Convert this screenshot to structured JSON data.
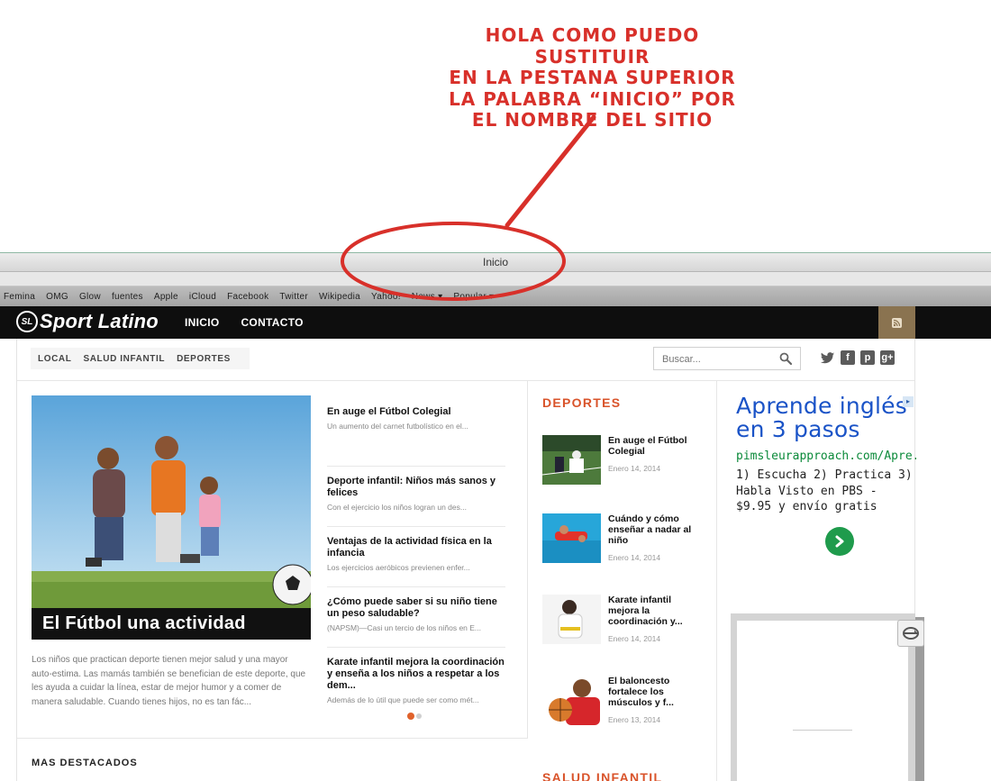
{
  "annotation": {
    "line1": "HOLA COMO PUEDO SUSTITUIR",
    "line2": "EN LA PESTANA SUPERIOR",
    "line3": "LA PALABRA “INICIO” POR",
    "line4": "EL NOMBRE DEL SITIO",
    "color": "#d8302a"
  },
  "browser": {
    "tab_title": "Inicio",
    "bookmarks": [
      "Femina",
      "OMG",
      "Glow",
      "fuentes",
      "Apple",
      "iCloud",
      "Facebook",
      "Twitter",
      "Wikipedia",
      "Yahoo!",
      "News ▾",
      "Popular ▾"
    ]
  },
  "header": {
    "logo_mark": "SL",
    "logo_text": "Sport Latino",
    "nav": [
      "INICIO",
      "CONTACTO"
    ],
    "rss_icon": "rss-icon",
    "accent": "#8a7350"
  },
  "subnav": {
    "items": [
      "LOCAL",
      "SALUD INFANTIL",
      "DEPORTES"
    ],
    "search_placeholder": "Buscar...",
    "social_icons": [
      "twitter-icon",
      "facebook-icon",
      "pinterest-icon",
      "google-plus-icon"
    ],
    "social_glyphs": [
      "",
      "f",
      "p",
      "g+"
    ]
  },
  "featured": {
    "caption": "El Fútbol una actividad Familiar",
    "excerpt": "Los niños que practican deporte tienen mejor salud y una mayor auto-estima. Las mamás también se benefician de este deporte, que les ayuda a cuidar la línea, estar de mejor humor y a comer de manera saludable. Cuando tienes hijos, no es tan fác..."
  },
  "slider_items": [
    {
      "title": "En auge el Fútbol Colegial",
      "excerpt": "Un aumento del carnet futbolístico en el..."
    },
    {
      "title": "Deporte infantil: Niños más sanos y felices",
      "excerpt": "Con el ejercicio los niños logran un des..."
    },
    {
      "title": "Ventajas de la actividad física en la infancia",
      "excerpt": "Los ejercicios aeróbicos previenen enfer..."
    },
    {
      "title": "¿Cómo puede saber si su niño tiene un peso saludable?",
      "excerpt": "(NAPSM)—Casi un tercio de los niños en E..."
    },
    {
      "title": "Karate infantil mejora la coordinación y enseña a los niños a respetar a los dem...",
      "excerpt": "Además de lo útil que puede ser como mét..."
    }
  ],
  "mas_destacados": "MAS DESTACADOS",
  "deportes": {
    "title": "DEPORTES",
    "items": [
      {
        "title": "En auge el Fútbol Colegial",
        "date": "Enero 14, 2014"
      },
      {
        "title": "Cuándo y cómo enseñar a nadar al niño",
        "date": "Enero 14, 2014"
      },
      {
        "title": "Karate infantil mejora la coordinación y...",
        "date": "Enero 14, 2014"
      },
      {
        "title": "El baloncesto fortalece los músculos y f...",
        "date": "Enero 13, 2014"
      }
    ]
  },
  "salud_title": "SALUD INFANTIL",
  "ad": {
    "title": "Aprende inglés en 3 pasos",
    "url": "pimsleurapproach.com/Apre...",
    "body": "1) Escucha 2) Practica 3) Habla Visto en PBS - $9.95 y envío gratis",
    "choice_icon": "ad-choices-icon"
  }
}
